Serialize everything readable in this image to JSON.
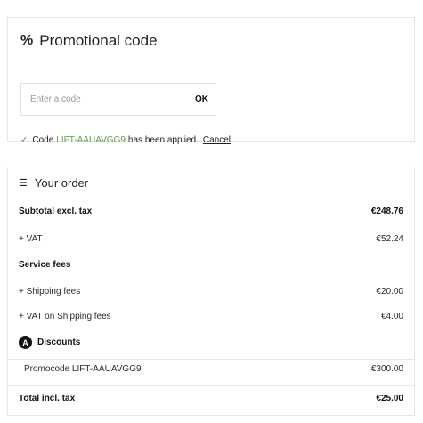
{
  "promo": {
    "icon": "percent-icon",
    "title": "Promotional code",
    "input_placeholder": "Enter a code",
    "ok_label": "OK",
    "applied_prefix": "Code",
    "applied_code": "LIFT-AAUAVGG9",
    "applied_suffix": "has been applied.",
    "cancel_label": "Cancel",
    "accent_color": "#5aa14a"
  },
  "order": {
    "icon": "list-icon",
    "title": "Your order",
    "rows": [
      {
        "label": "Subtotal excl. tax",
        "value": "€248.76"
      },
      {
        "label": "+ VAT",
        "value": "€52.24"
      },
      {
        "label": "Service fees",
        "value": ""
      },
      {
        "label": "+ Shipping fees",
        "value": "€20.00"
      },
      {
        "label": "+ VAT on Shipping fees",
        "value": "€4.00"
      }
    ],
    "discounts_label": "Discounts",
    "discount_badge_letter": "A",
    "promocode_label": "Promocode LIFT-AAUAVGG9",
    "promocode_value": "€300.00",
    "total_label": "Total incl. tax",
    "total_value": "€25.00"
  }
}
